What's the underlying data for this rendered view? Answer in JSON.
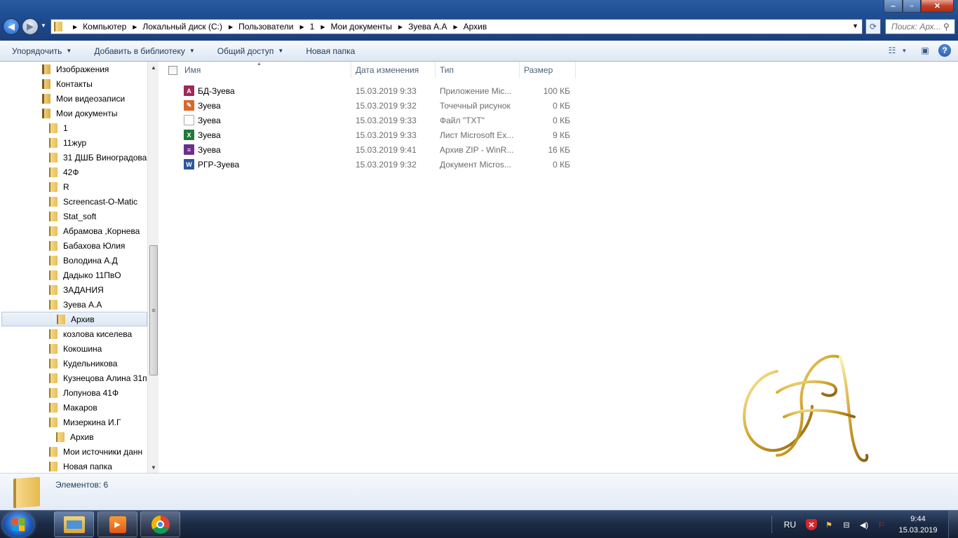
{
  "address": {
    "crumbs": [
      "Компьютер",
      "Локальный диск (C:)",
      "Пользователи",
      "1",
      "Мои документы",
      "Зуева А.А",
      "Архив"
    ]
  },
  "search": {
    "placeholder": "Поиск: Арх..."
  },
  "window_buttons": {
    "minimize": "‒",
    "maximize": "▫",
    "close": "✕"
  },
  "toolbar": {
    "organize": "Упорядочить",
    "add_to_library": "Добавить в библиотеку",
    "share": "Общий доступ",
    "new_folder": "Новая папка",
    "help_glyph": "?"
  },
  "nav_tree": [
    {
      "label": "Изображения",
      "level": 1,
      "lib": true
    },
    {
      "label": "Контакты",
      "level": 1,
      "lib": true
    },
    {
      "label": "Мои видеозаписи",
      "level": 1,
      "lib": true
    },
    {
      "label": "Мои документы",
      "level": 1,
      "lib": true
    },
    {
      "label": "1",
      "level": 2
    },
    {
      "label": "11жур",
      "level": 2
    },
    {
      "label": "31 ДШБ Виноградова",
      "level": 2
    },
    {
      "label": "42Ф",
      "level": 2
    },
    {
      "label": "R",
      "level": 2
    },
    {
      "label": "Screencast-O-Matic",
      "level": 2
    },
    {
      "label": "Stat_soft",
      "level": 2
    },
    {
      "label": "Абрамова ,Корнева",
      "level": 2
    },
    {
      "label": "Бабахова Юлия",
      "level": 2
    },
    {
      "label": "Володина А.Д",
      "level": 2
    },
    {
      "label": "Дадыко 11ПвО",
      "level": 2
    },
    {
      "label": "ЗАДАНИЯ",
      "level": 2
    },
    {
      "label": "Зуева А.А",
      "level": 2
    },
    {
      "label": "Архив",
      "level": 3,
      "selected": true
    },
    {
      "label": "козлова киселева",
      "level": 2
    },
    {
      "label": "Кокошина",
      "level": 2
    },
    {
      "label": "Кудельникова",
      "level": 2
    },
    {
      "label": "Кузнецова Алина 31п",
      "level": 2
    },
    {
      "label": "Лопунова 41Ф",
      "level": 2
    },
    {
      "label": "Макаров",
      "level": 2
    },
    {
      "label": "Мизеркина И.Г",
      "level": 2
    },
    {
      "label": "Архив",
      "level": 3
    },
    {
      "label": "Мои источники данн",
      "level": 2
    },
    {
      "label": "Новая папка",
      "level": 2
    }
  ],
  "columns": {
    "name": "Имя",
    "date": "Дата изменения",
    "type": "Тип",
    "size": "Размер"
  },
  "files": [
    {
      "name": "БД-Зуева",
      "date": "15.03.2019 9:33",
      "type": "Приложение Mic...",
      "size": "100 КБ",
      "icon": "access-icon",
      "color": "#a0285a",
      "glyph": "A"
    },
    {
      "name": "Зуева",
      "date": "15.03.2019 9:32",
      "type": "Точечный рисунок",
      "size": "0 КБ",
      "icon": "paint-icon",
      "color": "#d9682a",
      "glyph": "✎"
    },
    {
      "name": "Зуева",
      "date": "15.03.2019 9:33",
      "type": "Файл \"TXT\"",
      "size": "0 КБ",
      "icon": "text-file-icon",
      "color": "#ffffff",
      "glyph": ""
    },
    {
      "name": "Зуева",
      "date": "15.03.2019 9:33",
      "type": "Лист Microsoft Ex...",
      "size": "9 КБ",
      "icon": "excel-icon",
      "color": "#1f7a3a",
      "glyph": "X"
    },
    {
      "name": "Зуева",
      "date": "15.03.2019 9:41",
      "type": "Архив ZIP - WinR...",
      "size": "16 КБ",
      "icon": "winrar-icon",
      "color": "#6a2f8f",
      "glyph": "≡"
    },
    {
      "name": "РГР-Зуева",
      "date": "15.03.2019 9:32",
      "type": "Документ Micros...",
      "size": "0 КБ",
      "icon": "word-icon",
      "color": "#2b579a",
      "glyph": "W"
    }
  ],
  "details": {
    "count_text": "Элементов: 6"
  },
  "tray": {
    "lang": "RU",
    "time": "9:44",
    "date": "15.03.2019"
  }
}
